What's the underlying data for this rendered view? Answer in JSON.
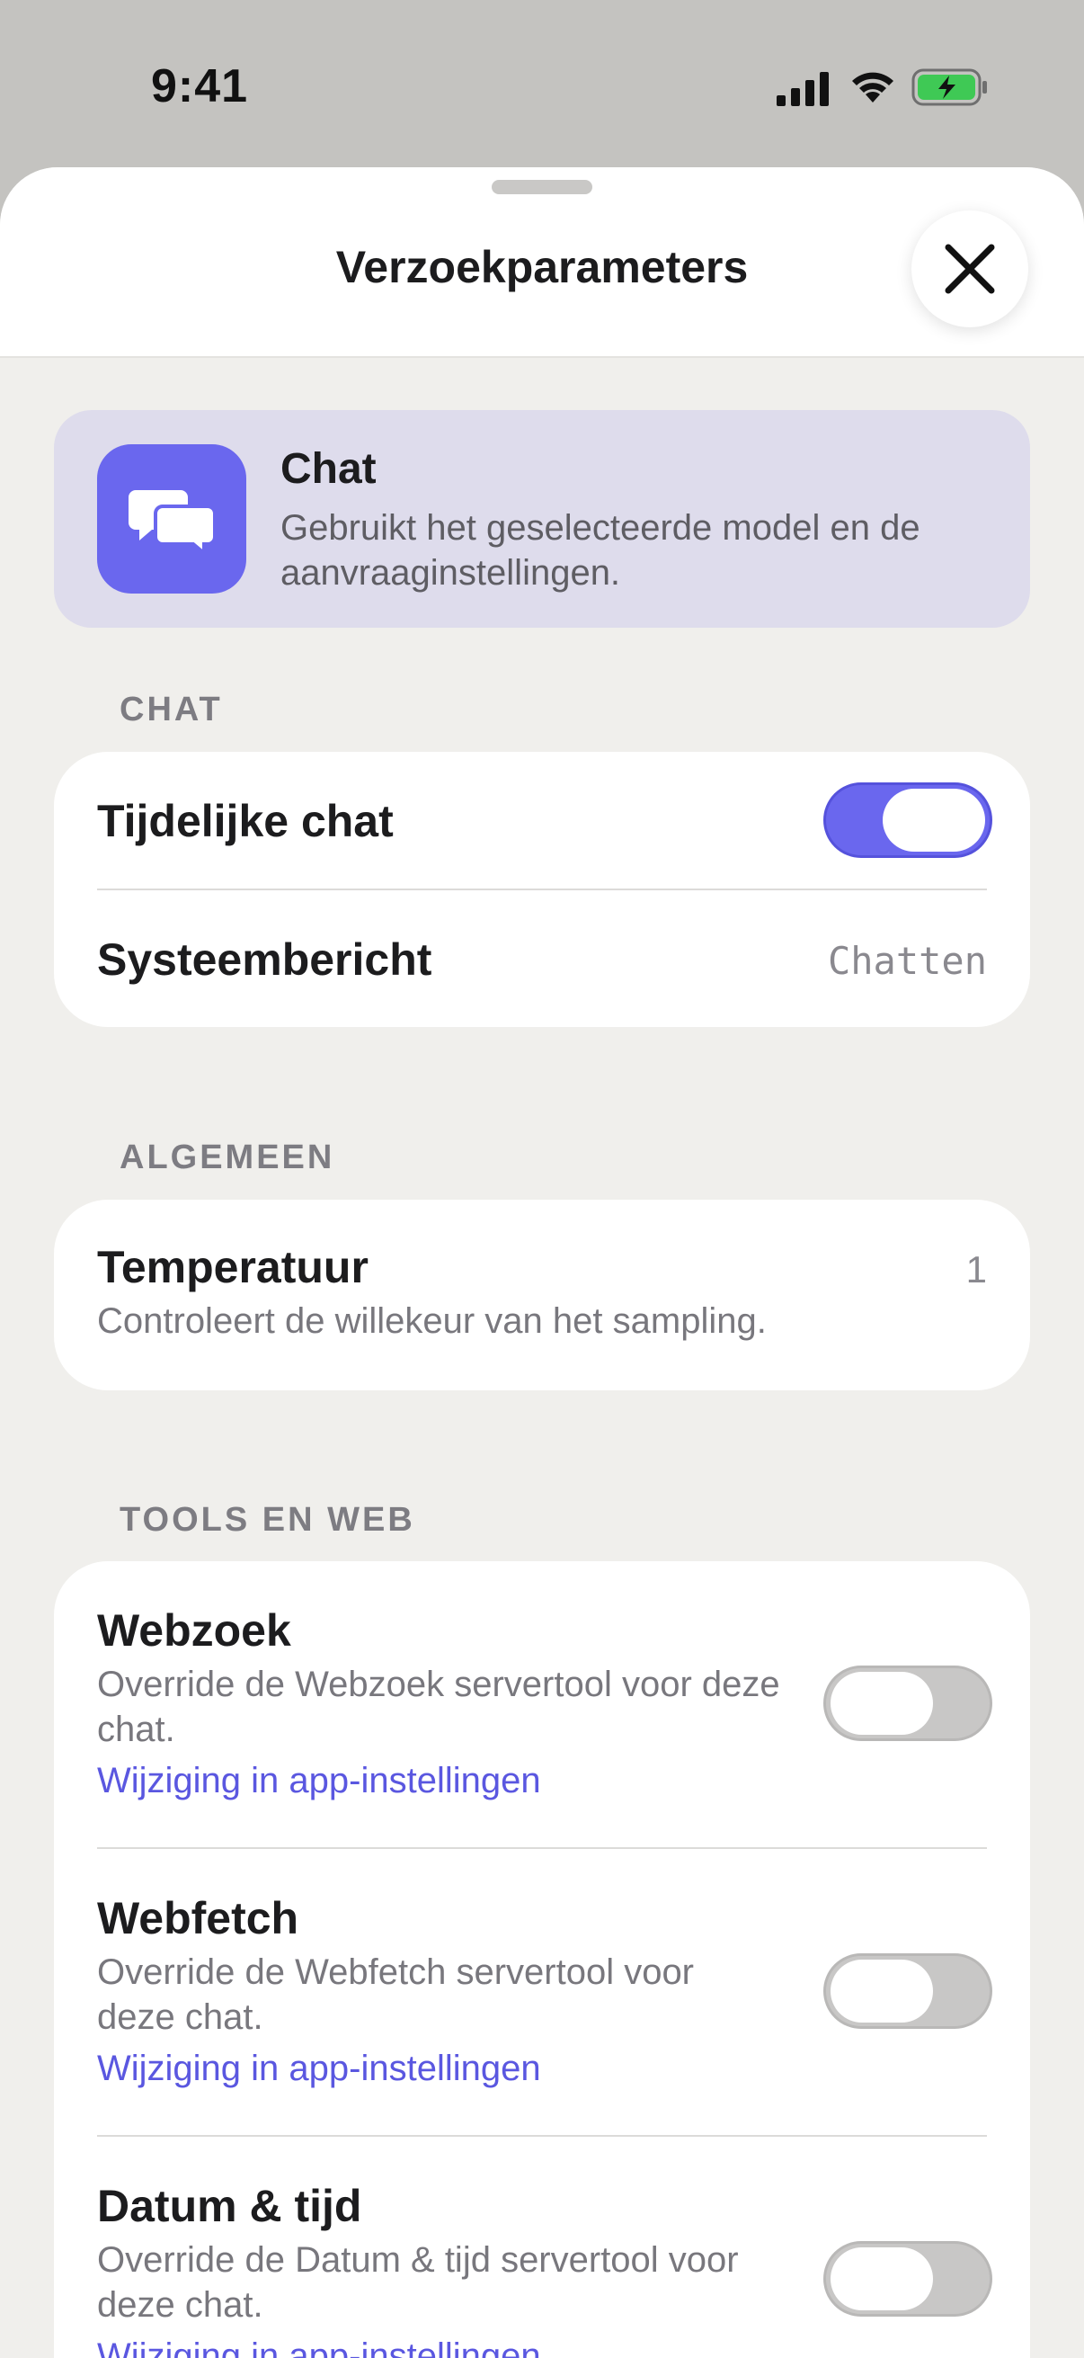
{
  "status_bar": {
    "time": "9:41",
    "icons": [
      "cellular-signal-icon",
      "wifi-icon",
      "battery-charging-icon"
    ]
  },
  "sheet": {
    "title": "Verzoekparameters",
    "close_icon": "close-icon"
  },
  "mode": {
    "icon": "chat-bubbles-icon",
    "title": "Chat",
    "description": "Gebruikt het geselecteerde model en de aanvraaginstellingen."
  },
  "chat_section": {
    "label": "CHAT",
    "temporary_chat": {
      "label": "Tijdelijke chat",
      "enabled": true
    },
    "system_message": {
      "label": "Systeembericht",
      "value": "Chatten"
    }
  },
  "general_section": {
    "label": "ALGEMEEN",
    "temperature": {
      "label": "Temperatuur",
      "description": "Controleert de willekeur van het sampling.",
      "value": "1"
    }
  },
  "tools_section": {
    "label": "TOOLS EN WEB",
    "items": [
      {
        "title": "Webzoek",
        "description": "Override de Webzoek servertool voor deze chat.",
        "link": "Wijziging in app-instellingen",
        "enabled": false
      },
      {
        "title": "Webfetch",
        "description": "Override de Webfetch servertool voor deze chat.",
        "link": "Wijziging in app-instellingen",
        "enabled": false
      },
      {
        "title": "Datum & tijd",
        "description": "Override de Datum & tijd servertool voor deze chat.",
        "link": "Wijziging in app-instellingen",
        "enabled": false
      }
    ]
  },
  "colors": {
    "accent": "#6a67ee",
    "link": "#5a57e0",
    "sheet_background": "#f0efec",
    "mode_card_background": "#dedcec"
  }
}
